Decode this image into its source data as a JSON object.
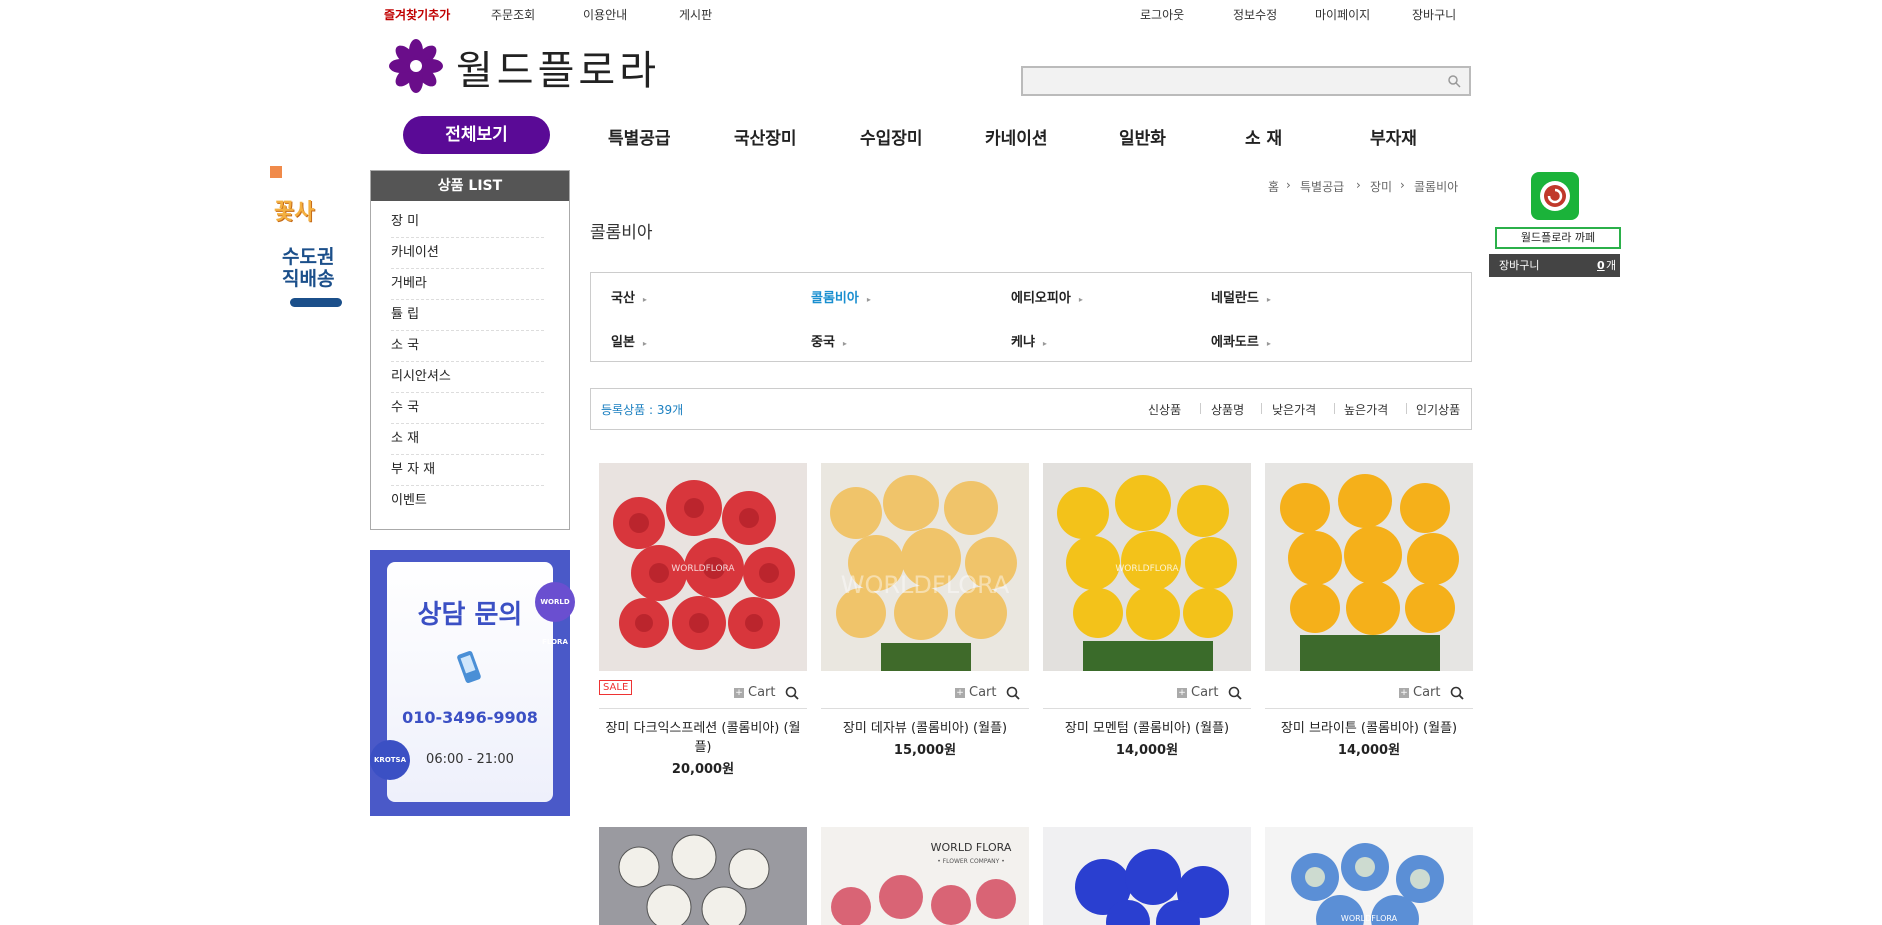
{
  "top_links": {
    "bookmark": "즐겨찾기추가",
    "order_lookup": "주문조회",
    "guide": "이용안내",
    "board": "게시판",
    "logout": "로그아웃",
    "edit_info": "정보수정",
    "mypage": "마이페이지",
    "cart": "장바구니"
  },
  "logo": {
    "text": "월드플로라",
    "color": "#6a0d8a"
  },
  "search": {
    "value": "",
    "placeholder": ""
  },
  "nav": {
    "all": "전체보기",
    "items": [
      "특별공급",
      "국산장미",
      "수입장미",
      "카네이션",
      "일반화",
      "소 재",
      "부자재"
    ],
    "accent": "#5a0a96"
  },
  "left_banner": {
    "line1": "꽃사",
    "line2": "수도권",
    "line3": "직배송"
  },
  "product_list": {
    "title": "상품 LIST",
    "items": [
      "장 미",
      "카네이션",
      "거베라",
      "튤 립",
      "소 국",
      "리시안셔스",
      "수 국",
      "소 재",
      "부 자 재",
      "이벤트"
    ]
  },
  "consult": {
    "title": "상담 문의",
    "phone": "010-3496-9908",
    "hours": "06:00 - 21:00",
    "badge1": "WORLD FLORA",
    "badge2": "KROTSA"
  },
  "breadcrumb": [
    "홈",
    "특별공급",
    "장미",
    "콜롬비아"
  ],
  "page_title": "콜롬비아",
  "origins": [
    "국산",
    "콜롬비아",
    "에티오피아",
    "네덜란드",
    "일본",
    "중국",
    "케냐",
    "에콰도르"
  ],
  "active_origin": "콜롬비아",
  "listing": {
    "count_label": "등록상품 : 39개",
    "sorts": [
      "신상품",
      "상품명",
      "낮은가격",
      "높은가격",
      "인기상품"
    ]
  },
  "products": [
    {
      "name": "장미 다크익스프레션 (콜롬비아) (월플)",
      "price": "20,000원",
      "sale": "SALE",
      "cart": "Cart",
      "watermark": "WORLDFLORA",
      "color": "#d8363c"
    },
    {
      "name": "장미 데자뷰 (콜롬비아) (월플)",
      "price": "15,000원",
      "cart": "Cart",
      "watermark": "WORLDFLORA",
      "color": "#f0c46a"
    },
    {
      "name": "장미 모멘텀 (콜롬비아) (월플)",
      "price": "14,000원",
      "cart": "Cart",
      "watermark": "WORLDFLORA",
      "color": "#f3c21a"
    },
    {
      "name": "장미 브라이튼 (콜롬비아) (월플)",
      "price": "14,000원",
      "cart": "Cart",
      "color": "#f5b01a"
    }
  ],
  "products_row2": [
    {
      "color": "#e8e6df"
    },
    {
      "color": "#d96475",
      "watermark": "WORLD FLORA",
      "watermark2": "• FLOWER COMPANY •"
    },
    {
      "color": "#2a3fd0"
    },
    {
      "color": "#5b8fd6",
      "watermark": "WORLDFLORA"
    }
  ],
  "quick": {
    "cafe": "월드플로라 까페",
    "cart_label": "장바구니",
    "cart_count": "0",
    "cart_unit": "개"
  }
}
